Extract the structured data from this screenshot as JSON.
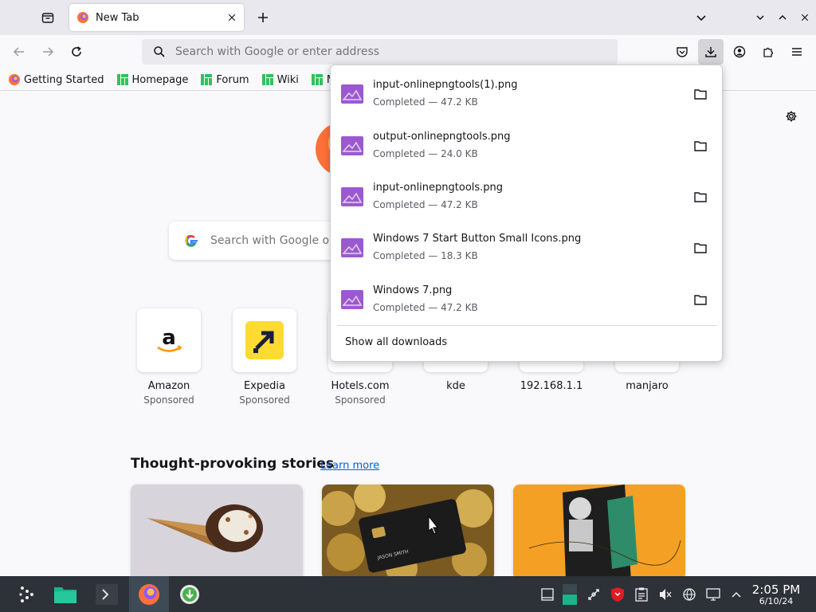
{
  "browser": {
    "tab": {
      "title": "New Tab"
    },
    "url_placeholder": "Search with Google or enter address",
    "bookmarks": [
      {
        "label": "Getting Started",
        "icon": "firefox-icon"
      },
      {
        "label": "Homepage",
        "icon": "manjaro-icon"
      },
      {
        "label": "Forum",
        "icon": "manjaro-icon"
      },
      {
        "label": "Wiki",
        "icon": "manjaro-icon"
      },
      {
        "label": "Ma",
        "icon": "manjaro-icon"
      }
    ]
  },
  "newtab": {
    "search_placeholder": "Search with Google or enter address",
    "top_sites": [
      {
        "name": "Amazon",
        "sub": "Sponsored",
        "icon": "amazon-icon"
      },
      {
        "name": "Expedia",
        "sub": "Sponsored",
        "icon": "expedia-icon"
      },
      {
        "name": "Hotels.com",
        "sub": "Sponsored",
        "icon": "hotels-icon"
      },
      {
        "name": "kde",
        "sub": "",
        "icon": "site-icon"
      },
      {
        "name": "192.168.1.1",
        "sub": "",
        "icon": "site-icon"
      },
      {
        "name": "manjaro",
        "sub": "",
        "icon": "site-icon"
      }
    ],
    "stories_title": "Thought-provoking stories",
    "learn_more": "Learn more",
    "story_card_text": "JASON SMITH"
  },
  "downloads": {
    "items": [
      {
        "name": "input-onlinepngtools(1).png",
        "status": "Completed — 47.2 KB"
      },
      {
        "name": "output-onlinepngtools.png",
        "status": "Completed — 24.0 KB"
      },
      {
        "name": "input-onlinepngtools.png",
        "status": "Completed — 47.2 KB"
      },
      {
        "name": "Windows 7 Start Button Small Icons.png",
        "status": "Completed — 18.3 KB"
      },
      {
        "name": "Windows 7.png",
        "status": "Completed — 47.2 KB"
      }
    ],
    "show_all": "Show all downloads"
  },
  "taskbar": {
    "time": "2:05 PM",
    "date": "6/10/24"
  },
  "colors": {
    "accent": "#0061e0",
    "taskbar": "#2d3138",
    "file_icon": "#9b59d0"
  }
}
